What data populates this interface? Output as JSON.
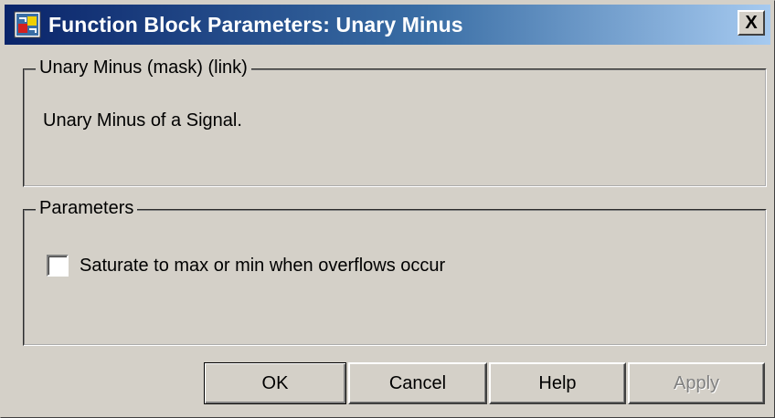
{
  "window": {
    "title": "Function Block Parameters: Unary Minus",
    "close_label": "X"
  },
  "description_group": {
    "legend": "Unary Minus (mask) (link)",
    "text": "Unary Minus of a Signal."
  },
  "parameters_group": {
    "legend": "Parameters",
    "checkbox_label": "Saturate to max or min when overflows occur",
    "checkbox_checked": false
  },
  "buttons": {
    "ok": "OK",
    "cancel": "Cancel",
    "help": "Help",
    "apply": "Apply"
  },
  "icons": {
    "app": "simulink-block-icon",
    "close": "close-icon"
  },
  "colors": {
    "titlebar_start": "#0a246a",
    "titlebar_end": "#a6caf0",
    "face": "#d4d0c8",
    "disabled_text": "#808080"
  }
}
